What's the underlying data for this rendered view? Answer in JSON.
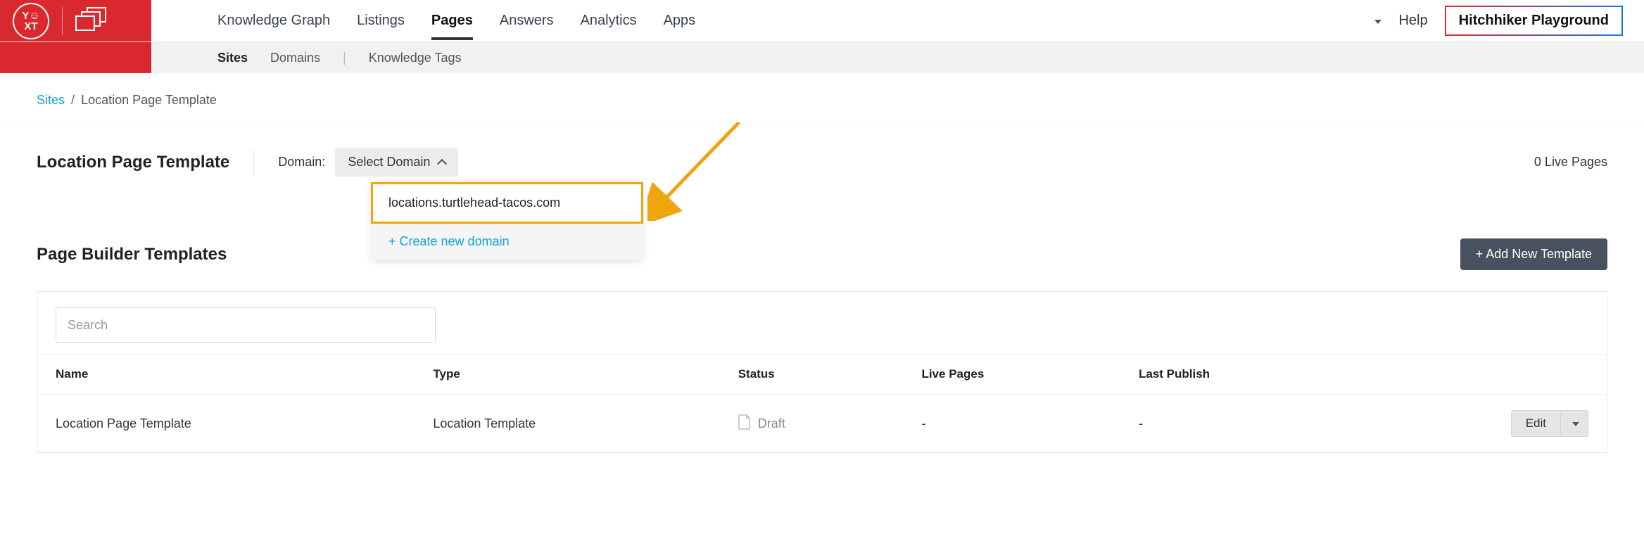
{
  "brand": {
    "logo_text": "Y☺\nXT"
  },
  "topnav": {
    "items": [
      {
        "label": "Knowledge Graph"
      },
      {
        "label": "Listings"
      },
      {
        "label": "Pages",
        "active": true
      },
      {
        "label": "Answers"
      },
      {
        "label": "Analytics"
      },
      {
        "label": "Apps"
      }
    ],
    "help_label": "Help",
    "playground_label": "Hitchhiker Playground"
  },
  "subnav": {
    "items": [
      {
        "label": "Sites",
        "active": true
      },
      {
        "label": "Domains"
      },
      {
        "label": "Knowledge Tags"
      }
    ]
  },
  "breadcrumb": {
    "root": "Sites",
    "sep": "/",
    "current": "Location Page Template"
  },
  "title_row": {
    "title": "Location Page Template",
    "domain_label": "Domain:",
    "select_domain_label": "Select Domain",
    "live_pages_label": "0 Live Pages"
  },
  "domain_dropdown": {
    "options": [
      "locations.turtlehead-tacos.com"
    ],
    "create_label": "+ Create new domain"
  },
  "section": {
    "title": "Page Builder Templates",
    "add_button_label": "+ Add New Template"
  },
  "table": {
    "search_placeholder": "Search",
    "columns": [
      "Name",
      "Type",
      "Status",
      "Live Pages",
      "Last Publish",
      ""
    ],
    "rows": [
      {
        "name": "Location Page Template",
        "type": "Location Template",
        "status": "Draft",
        "live_pages": "-",
        "last_publish": "-",
        "edit_label": "Edit"
      }
    ]
  }
}
